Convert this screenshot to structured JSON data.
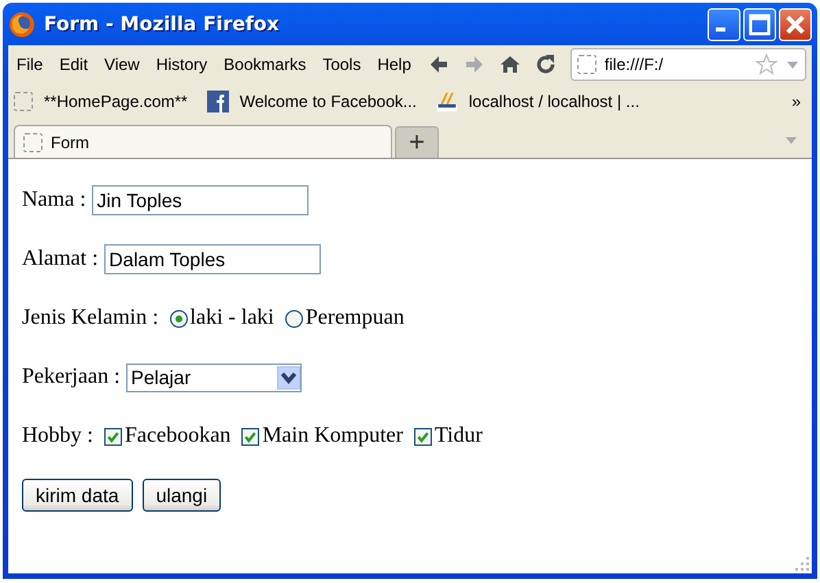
{
  "window": {
    "title": "Form - Mozilla Firefox"
  },
  "menu": [
    "File",
    "Edit",
    "View",
    "History",
    "Bookmarks",
    "Tools",
    "Help"
  ],
  "address": {
    "value": "file:///F:/"
  },
  "bookmarks": [
    {
      "label": "**HomePage.com**",
      "kind": "blank"
    },
    {
      "label": "Welcome to Facebook...",
      "kind": "facebook"
    },
    {
      "label": "localhost / localhost | ...",
      "kind": "pma"
    }
  ],
  "bookmarks_more": "»",
  "tabs": [
    {
      "label": "Form",
      "selected": true
    }
  ],
  "new_tab": "+",
  "form": {
    "fields": [
      {
        "label": "Nama :",
        "value": "Jin Toples",
        "kind": "text"
      },
      {
        "label": "Alamat :",
        "value": "Dalam Toples",
        "kind": "text"
      },
      {
        "label": "Jenis Kelamin :",
        "kind": "radio",
        "options": [
          {
            "label": "laki - laki",
            "selected": true
          },
          {
            "label": "Perempuan",
            "selected": false
          }
        ]
      },
      {
        "label": "Pekerjaan :",
        "kind": "select",
        "value": "Pelajar"
      },
      {
        "label": "Hobby :",
        "kind": "checkbox",
        "options": [
          {
            "label": "Facebookan",
            "checked": true
          },
          {
            "label": "Main Komputer",
            "checked": true
          },
          {
            "label": "Tidur",
            "checked": true
          }
        ]
      }
    ],
    "buttons": [
      "kirim data",
      "ulangi"
    ]
  }
}
